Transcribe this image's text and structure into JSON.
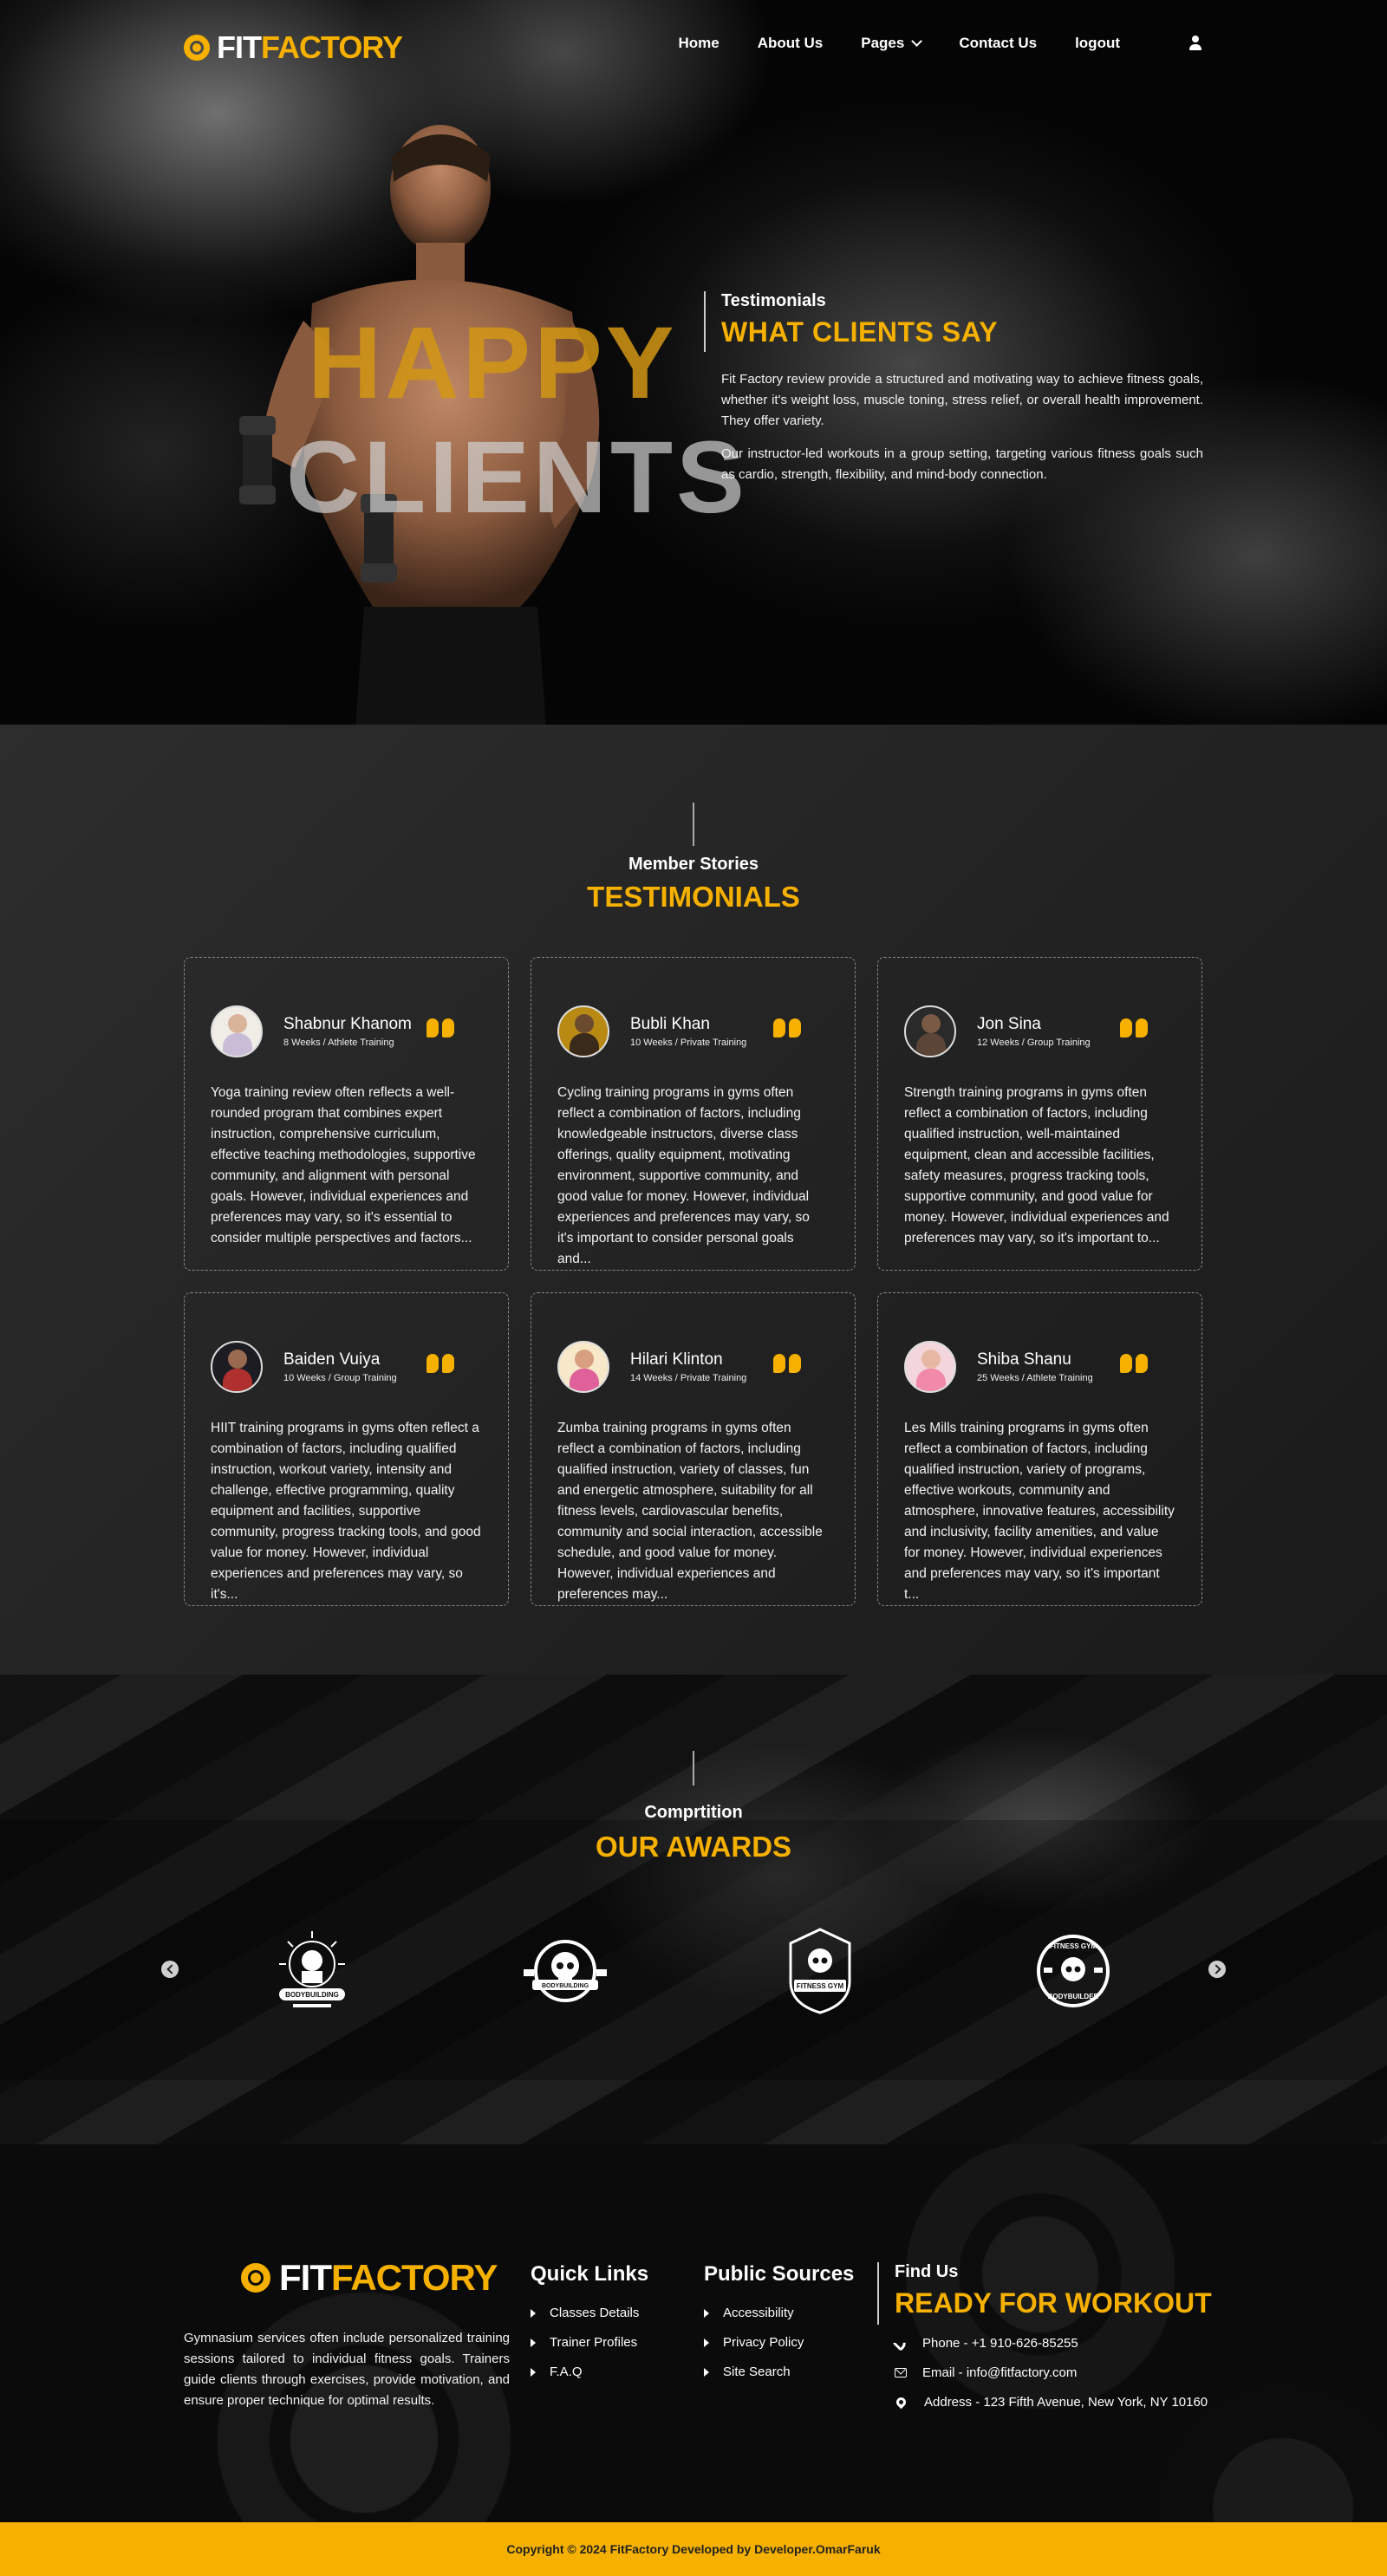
{
  "brand": {
    "part1": "FIT",
    "part2": "FACTORY"
  },
  "nav": {
    "home": "Home",
    "about": "About Us",
    "pages": "Pages",
    "contact": "Contact Us",
    "logout": "logout"
  },
  "hero": {
    "word1": "HAPPY",
    "word2": "CLIENTS",
    "subtitle": "Testimonials",
    "title": "WHAT CLIENTS SAY",
    "paragraph1": "Fit Factory review provide a structured and motivating way to achieve fitness goals, whether it's weight loss, muscle toning, stress relief, or overall health improvement. They offer variety.",
    "paragraph2": "Our instructor-led workouts in a group setting, targeting various fitness goals such as cardio, strength, flexibility, and mind-body connection."
  },
  "testimonials": {
    "subtitle": "Member Stories",
    "title": "TESTIMONIALS",
    "items": [
      {
        "name": "Shabnur Khanom",
        "meta": "8 Weeks / Athlete Training",
        "text": "Yoga training review often reflects a well-rounded program that combines expert instruction, comprehensive curriculum, effective teaching methodologies, supportive community, and alignment with personal goals. However, individual experiences and preferences may vary, so it's essential to consider multiple perspectives and factors..."
      },
      {
        "name": "Bubli Khan",
        "meta": "10 Weeks / Private Training",
        "text": "Cycling training programs in gyms often reflect a combination of factors, including knowledgeable instructors, diverse class offerings, quality equipment, motivating environment, supportive community, and good value for money. However, individual experiences and preferences may vary, so it's important to consider personal goals and..."
      },
      {
        "name": "Jon Sina",
        "meta": "12 Weeks / Group Training",
        "text": "Strength training programs in gyms often reflect a combination of factors, including qualified instruction, well-maintained equipment, clean and accessible facilities, safety measures, progress tracking tools, supportive community, and good value for money. However, individual experiences and preferences may vary, so it's important to..."
      },
      {
        "name": "Baiden Vuiya",
        "meta": "10 Weeks / Group Training",
        "text": "HIIT training programs in gyms often reflect a combination of factors, including qualified instruction, workout variety, intensity and challenge, effective programming, quality equipment and facilities, supportive community, progress tracking tools, and good value for money. However, individual experiences and preferences may vary, so it's..."
      },
      {
        "name": "Hilari Klinton",
        "meta": "14 Weeks / Private Training",
        "text": "Zumba training programs in gyms often reflect a combination of factors, including qualified instruction, variety of classes, fun and energetic atmosphere, suitability for all fitness levels, cardiovascular benefits, community and social interaction, accessible schedule, and good value for money. However, individual experiences and preferences may..."
      },
      {
        "name": "Shiba Shanu",
        "meta": "25 Weeks / Athlete Training",
        "text": "Les Mills training programs in gyms often reflect a combination of factors, including qualified instruction, variety of programs, effective workouts, community and atmosphere, innovative features, accessibility and inclusivity, facility amenities, and value for money. However, individual experiences and preferences may vary, so it's important t..."
      }
    ]
  },
  "awards": {
    "subtitle": "Comprtition",
    "title": "OUR AWARDS",
    "badges": [
      {
        "text": "BODYBUILDING"
      },
      {
        "text": "BODYBUILDING"
      },
      {
        "text": "FITNESS GYM"
      },
      {
        "text1": "FITNESS GYM",
        "text2": "BODYBUILDER"
      }
    ]
  },
  "footer": {
    "about": "Gymnasium services often include personalized training sessions tailored to individual fitness goals. Trainers guide clients through exercises, provide motivation, and ensure proper technique for optimal results.",
    "quick_links_title": "Quick Links",
    "quick_links": [
      "Classes Details",
      "Trainer Profiles",
      "F.A.Q"
    ],
    "public_sources_title": "Public Sources",
    "public_sources": [
      "Accessibility",
      "Privacy Policy",
      "Site Search"
    ],
    "find_us": "Find Us",
    "ready": "READY FOR WORKOUT",
    "phone": "Phone - +1 910-626-85255",
    "email": "Email - info@fitfactory.com",
    "address": "Address - 123 Fifth Avenue, New York, NY 10160"
  },
  "copyright": "Copyright © 2024 FitFactory Developed by Developer.OmarFaruk",
  "colors": {
    "accent": "#f5b000",
    "dark": "#0b0b0b",
    "card_border": "#8a8a8a"
  }
}
